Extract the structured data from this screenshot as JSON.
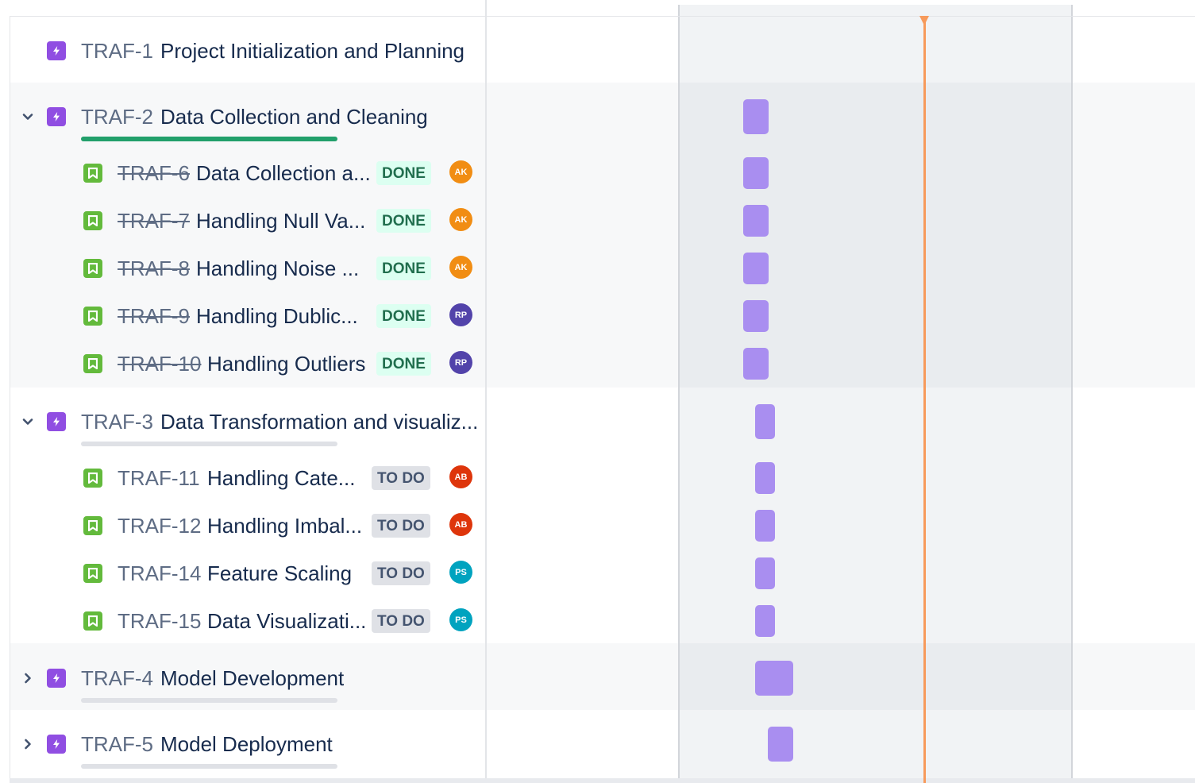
{
  "colors": {
    "epic_icon": "#904ee2",
    "story_icon": "#63ba3c",
    "bar": "#a98ef0",
    "today_line": "#f79a5b",
    "progress_done": "#22a06b",
    "progress_track": "#dfe1e6",
    "status_done_bg": "#dcfff1",
    "status_done_text": "#216e4e",
    "status_todo_bg": "#dfe1e6",
    "status_todo_text": "#44546f"
  },
  "epics": [
    {
      "key": "TRAF-1",
      "title": "Project Initialization and Planning",
      "icon": "lightning-icon",
      "chevron": "none",
      "progress_done": null
    },
    {
      "key": "TRAF-2",
      "title": "Data Collection and Cleaning",
      "icon": "lightning-icon",
      "chevron": "chevron-down-icon",
      "progress_done": 1.0,
      "children": [
        {
          "key": "TRAF-6",
          "title": "Data Collection a...",
          "status": "DONE",
          "assignee": "AK",
          "assignee_color": "#f18d13",
          "resolved": true
        },
        {
          "key": "TRAF-7",
          "title": "Handling Null Va...",
          "status": "DONE",
          "assignee": "AK",
          "assignee_color": "#f18d13",
          "resolved": true
        },
        {
          "key": "TRAF-8",
          "title": "Handling Noise ...",
          "status": "DONE",
          "assignee": "AK",
          "assignee_color": "#f18d13",
          "resolved": true
        },
        {
          "key": "TRAF-9",
          "title": "Handling Dublic...",
          "status": "DONE",
          "assignee": "RP",
          "assignee_color": "#5243aa",
          "resolved": true
        },
        {
          "key": "TRAF-10",
          "title": "Handling Outliers",
          "status": "DONE",
          "assignee": "RP",
          "assignee_color": "#5243aa",
          "resolved": true
        }
      ]
    },
    {
      "key": "TRAF-3",
      "title": "Data Transformation and visualiz...",
      "icon": "lightning-icon",
      "chevron": "chevron-down-icon",
      "progress_done": 0.0,
      "children": [
        {
          "key": "TRAF-11",
          "title": "Handling Cate...",
          "status": "TO DO",
          "assignee": "AB",
          "assignee_color": "#de350b",
          "resolved": false
        },
        {
          "key": "TRAF-12",
          "title": "Handling Imbal...",
          "status": "TO DO",
          "assignee": "AB",
          "assignee_color": "#de350b",
          "resolved": false
        },
        {
          "key": "TRAF-14",
          "title": "Feature Scaling",
          "status": "TO DO",
          "assignee": "PS",
          "assignee_color": "#00a3bf",
          "resolved": false
        },
        {
          "key": "TRAF-15",
          "title": "Data Visualizati...",
          "status": "TO DO",
          "assignee": "PS",
          "assignee_color": "#00a3bf",
          "resolved": false
        }
      ]
    },
    {
      "key": "TRAF-4",
      "title": "Model Development",
      "icon": "lightning-icon",
      "chevron": "chevron-right-icon",
      "progress_done": 0.0
    },
    {
      "key": "TRAF-5",
      "title": "Model Deployment",
      "icon": "lightning-icon",
      "chevron": "chevron-right-icon",
      "progress_done": 0.0
    }
  ]
}
